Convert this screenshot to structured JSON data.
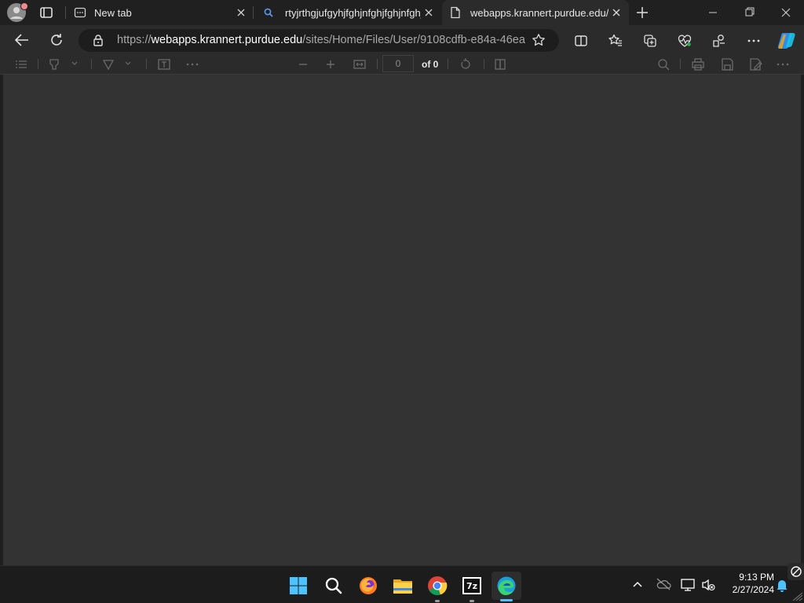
{
  "browser": {
    "tabs": [
      {
        "title": "New tab"
      },
      {
        "title": "rtyjrthgjufgyhjfghjnfghjfghjnfghjnfghj"
      },
      {
        "title": "webapps.krannert.purdue.edu/sites/"
      }
    ],
    "active_tab_index": 2,
    "address": {
      "scheme": "https://",
      "host": "webapps.krannert.purdue.edu",
      "path": "/sites/Home/Files/User/9108cdfb-e84a-46ea..."
    }
  },
  "pdf_toolbar": {
    "page_number": "0",
    "page_total": "of 0"
  },
  "taskbar": {
    "time": "9:13 PM",
    "date": "2/27/2024",
    "apps": [
      "start-icon",
      "search-icon",
      "firefox-icon",
      "file-explorer-icon",
      "chrome-icon",
      "7zip-icon",
      "edge-icon"
    ],
    "seven_zip_label": "7z"
  }
}
